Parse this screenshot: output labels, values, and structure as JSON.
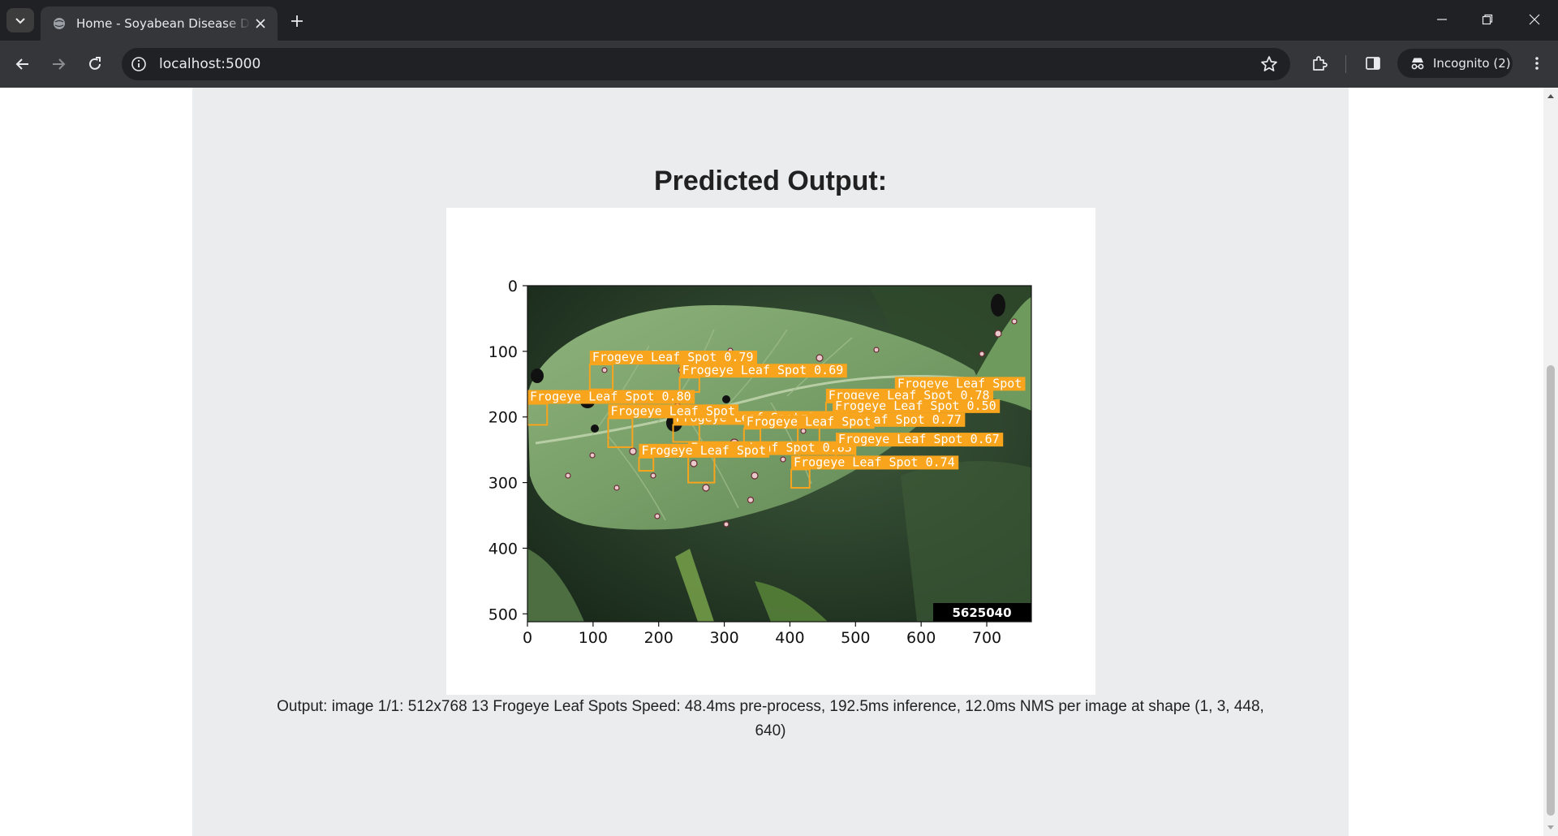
{
  "browser": {
    "tab_title": "Home - Soyabean Disease Detection",
    "url": "localhost:5000",
    "profile_label": "Incognito (2)",
    "icons": [
      "tab-search-icon",
      "globe-icon",
      "close-icon",
      "plus-icon",
      "minimize-icon",
      "restore-icon",
      "back-icon",
      "forward-icon",
      "reload-icon",
      "info-icon",
      "star-icon",
      "extensions-icon",
      "side-panel-icon",
      "incognito-icon",
      "more-vert-icon"
    ]
  },
  "page": {
    "heading": "Predicted Output:",
    "output_text": "Output: image 1/1: 512x768 13 Frogeye Leaf Spots Speed: 48.4ms pre-process, 192.5ms inference, 12.0ms NMS per image at shape (1, 3, 448, 640)"
  },
  "figure": {
    "image_size": [
      768,
      512
    ],
    "x_ticks": [
      "0",
      "100",
      "200",
      "300",
      "400",
      "500",
      "600",
      "700"
    ],
    "y_ticks": [
      "0",
      "100",
      "200",
      "300",
      "400",
      "500"
    ],
    "watermark": "5625040",
    "box_color": "#f8a41c",
    "detections": [
      {
        "label": "Frogeye Leaf Spot 0.79",
        "x1": 95,
        "y1": 120,
        "x2": 130,
        "y2": 158
      },
      {
        "label": "Frogeye Leaf Spot 0.69",
        "x1": 232,
        "y1": 140,
        "x2": 262,
        "y2": 162
      },
      {
        "label": "Frogeye Leaf Spot",
        "x1": 560,
        "y1": 160,
        "x2": 590,
        "y2": 180
      },
      {
        "label": "Frogeye Leaf Spot 0.80",
        "x1": 0,
        "y1": 180,
        "x2": 30,
        "y2": 212
      },
      {
        "label": "Frogeye Leaf Spot 0.80",
        "x1": 222,
        "y1": 212,
        "x2": 262,
        "y2": 238
      },
      {
        "label": "Frogeye Leaf Spot 0.78",
        "x1": 455,
        "y1": 178,
        "x2": 485,
        "y2": 200
      },
      {
        "label": "Frogeye Leaf Spot 0.50",
        "x1": 465,
        "y1": 194,
        "x2": 490,
        "y2": 214
      },
      {
        "label": "Frogeye Leaf Spot 0.77",
        "x1": 412,
        "y1": 215,
        "x2": 445,
        "y2": 238
      },
      {
        "label": "Frogeye Leaf Spot",
        "x1": 123,
        "y1": 202,
        "x2": 160,
        "y2": 246
      },
      {
        "label": "Frogeye Leaf Spot",
        "x1": 330,
        "y1": 218,
        "x2": 355,
        "y2": 240
      },
      {
        "label": "Frogeye Leaf Spot 0.83",
        "x1": 245,
        "y1": 258,
        "x2": 285,
        "y2": 300
      },
      {
        "label": "Frogeye Leaf Spot",
        "x1": 170,
        "y1": 262,
        "x2": 192,
        "y2": 282
      },
      {
        "label": "Frogeye Leaf Spot 0.67",
        "x1": 470,
        "y1": 245,
        "x2": 500,
        "y2": 266
      },
      {
        "label": "Frogeye Leaf Spot 0.74",
        "x1": 402,
        "y1": 280,
        "x2": 430,
        "y2": 308
      }
    ]
  }
}
